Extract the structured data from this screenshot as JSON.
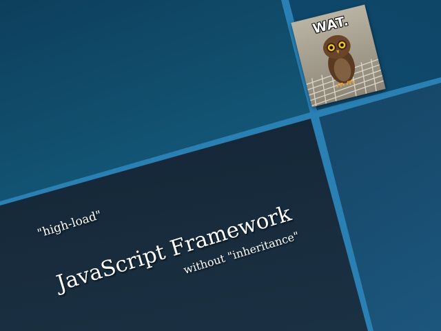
{
  "slide": {
    "subtitle_top": "\"high-load\"",
    "title": "JavaScript Framework",
    "subtitle_bottom": "without \"inheritance\"",
    "image": {
      "caption": "WAT.",
      "icon": "owl-photo"
    }
  },
  "colors": {
    "divider": "#2a7fb3",
    "panel_top": "#135575",
    "panel_bottom_left": "#16293a",
    "text": "#ffffff"
  }
}
